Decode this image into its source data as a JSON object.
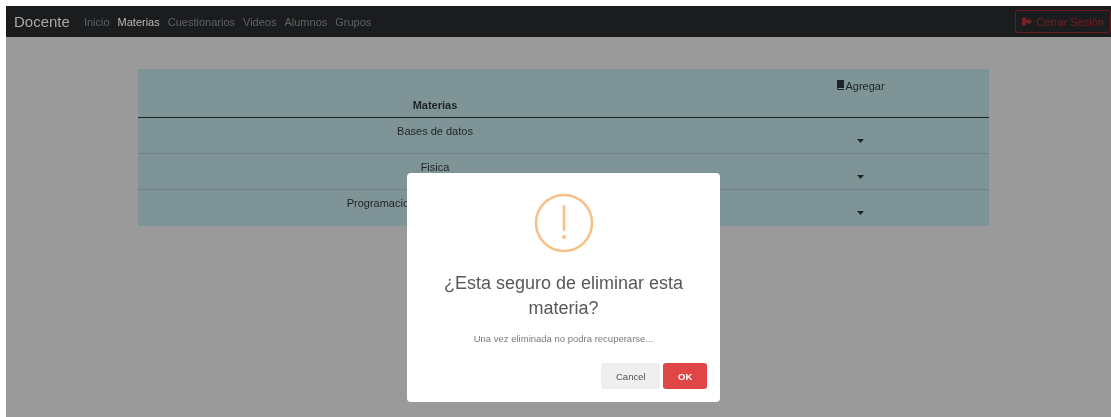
{
  "navbar": {
    "brand": "Docente",
    "links": [
      {
        "label": "Inicio",
        "selected": false
      },
      {
        "label": "Materias",
        "selected": true
      },
      {
        "label": "Cuestionarios",
        "selected": false
      },
      {
        "label": "Videos",
        "selected": false
      },
      {
        "label": "Alumnos",
        "selected": false
      },
      {
        "label": "Grupos",
        "selected": false
      }
    ],
    "logout": "Cerrar Sesión"
  },
  "table": {
    "columns": [
      "Materias",
      "Agregar"
    ],
    "rows": [
      {
        "name": "Bases de datos",
        "truncated": false
      },
      {
        "name": "Fisica",
        "truncated": false
      },
      {
        "name": "Programacio",
        "truncated": true
      }
    ]
  },
  "dialog": {
    "title": "¿Esta seguro de eliminar esta materia?",
    "message": "Una vez eliminada no podra recuperarse...",
    "buttons": [
      {
        "label": "Cancel",
        "kind": "cancel"
      },
      {
        "label": "OK",
        "kind": "confirm"
      }
    ]
  }
}
